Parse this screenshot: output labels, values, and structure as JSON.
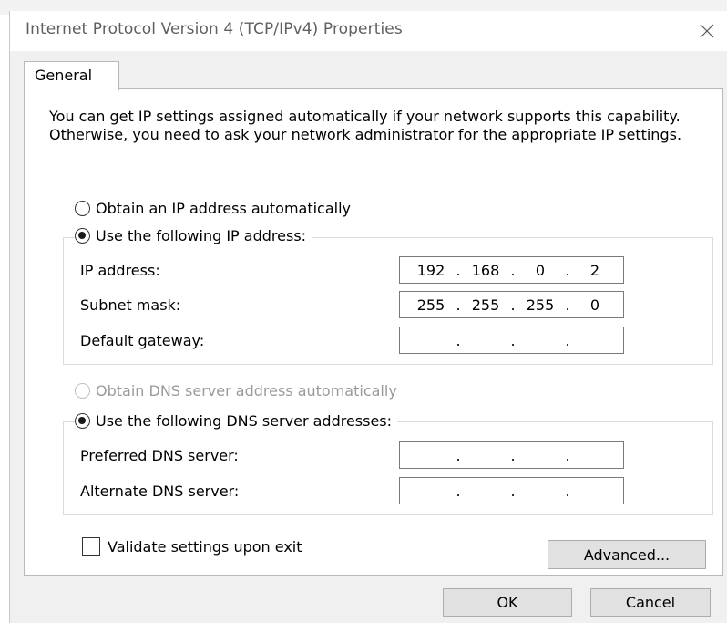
{
  "window": {
    "title": "Internet Protocol Version 4 (TCP/IPv4) Properties"
  },
  "tabs": [
    {
      "label": "General",
      "selected": true
    }
  ],
  "intro_text": "You can get IP settings assigned automatically if your network supports this capability. Otherwise, you need to ask your network administrator for the appropriate IP settings.",
  "ip_section": {
    "auto_label": "Obtain an IP address automatically",
    "manual_label": "Use the following IP address:",
    "selected": "manual",
    "fields": [
      {
        "label": "IP address:",
        "octets": [
          "192",
          "168",
          "0",
          "2"
        ]
      },
      {
        "label": "Subnet mask:",
        "octets": [
          "255",
          "255",
          "255",
          "0"
        ]
      },
      {
        "label": "Default gateway:",
        "octets": [
          "",
          "",
          "",
          ""
        ]
      }
    ]
  },
  "dns_section": {
    "auto_label": "Obtain DNS server address automatically",
    "auto_enabled": false,
    "manual_label": "Use the following DNS server addresses:",
    "selected": "manual",
    "fields": [
      {
        "label": "Preferred DNS server:",
        "octets": [
          "",
          "",
          "",
          ""
        ]
      },
      {
        "label": "Alternate DNS server:",
        "octets": [
          "",
          "",
          "",
          ""
        ]
      }
    ]
  },
  "validate": {
    "label": "Validate settings upon exit",
    "checked": false
  },
  "buttons": {
    "advanced": "Advanced...",
    "ok": "OK",
    "cancel": "Cancel"
  }
}
